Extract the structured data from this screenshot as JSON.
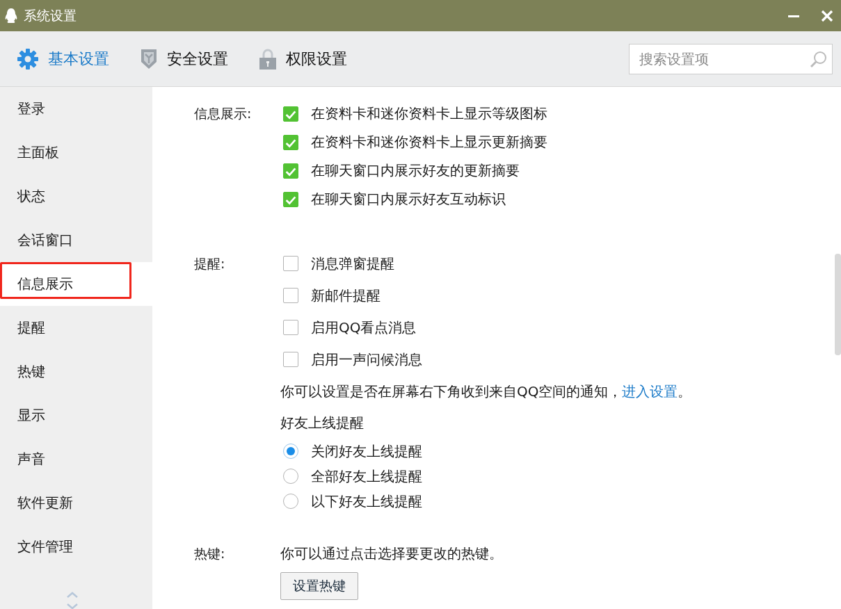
{
  "window": {
    "title": "系统设置"
  },
  "tabs": [
    {
      "label": "基本设置",
      "selected": true
    },
    {
      "label": "安全设置",
      "selected": false
    },
    {
      "label": "权限设置",
      "selected": false
    }
  ],
  "search": {
    "placeholder": "搜索设置项"
  },
  "sidebar": {
    "items": [
      {
        "label": "登录",
        "selected": false,
        "marked": false
      },
      {
        "label": "主面板",
        "selected": false,
        "marked": false
      },
      {
        "label": "状态",
        "selected": false,
        "marked": false
      },
      {
        "label": "会话窗口",
        "selected": false,
        "marked": false
      },
      {
        "label": "信息展示",
        "selected": true,
        "marked": true
      },
      {
        "label": "提醒",
        "selected": false,
        "marked": false
      },
      {
        "label": "热键",
        "selected": false,
        "marked": false
      },
      {
        "label": "显示",
        "selected": false,
        "marked": false
      },
      {
        "label": "声音",
        "selected": false,
        "marked": false
      },
      {
        "label": "软件更新",
        "selected": false,
        "marked": false
      },
      {
        "label": "文件管理",
        "selected": false,
        "marked": false
      }
    ]
  },
  "sections": [
    {
      "label": "信息展示:",
      "items": [
        {
          "kind": "checkbox",
          "text": "在资料卡和迷你资料卡上显示等级图标",
          "checked": true
        },
        {
          "kind": "checkbox",
          "text": "在资料卡和迷你资料卡上显示更新摘要",
          "checked": true
        },
        {
          "kind": "checkbox",
          "text": "在聊天窗口内展示好友的更新摘要",
          "checked": true
        },
        {
          "kind": "checkbox",
          "text": "在聊天窗口内展示好友互动标识",
          "checked": true
        }
      ]
    },
    {
      "label": "提醒:",
      "items": [
        {
          "kind": "checkbox",
          "text": "消息弹窗提醒",
          "checked": false
        },
        {
          "kind": "checkbox",
          "text": "新邮件提醒",
          "checked": false
        },
        {
          "kind": "checkbox",
          "text": "启用QQ看点消息",
          "checked": false
        },
        {
          "kind": "checkbox",
          "text": "启用一声问候消息",
          "checked": false
        },
        {
          "kind": "note",
          "text": "你可以设置是否在屏幕右下角收到来自QQ空间的通知，",
          "link": "进入设置",
          "after": "。"
        },
        {
          "kind": "heading",
          "text": "好友上线提醒"
        },
        {
          "kind": "radio",
          "text": "关闭好友上线提醒",
          "selected": true
        },
        {
          "kind": "radio",
          "text": "全部好友上线提醒",
          "selected": false
        },
        {
          "kind": "radio",
          "text": "以下好友上线提醒",
          "selected": false
        }
      ]
    },
    {
      "label": "热键:",
      "items": [
        {
          "kind": "note",
          "text": "你可以通过点击选择要更改的热键。"
        },
        {
          "kind": "button",
          "text": "设置热键"
        }
      ]
    }
  ]
}
